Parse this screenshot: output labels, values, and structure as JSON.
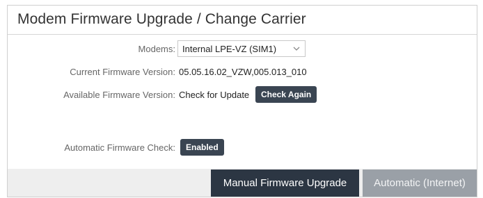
{
  "panel": {
    "title": "Modem Firmware Upgrade / Change Carrier"
  },
  "fields": {
    "modems": {
      "label": "Modems:",
      "selected": "Internal LPE-VZ (SIM1)"
    },
    "current_version": {
      "label": "Current Firmware Version:",
      "value": "05.05.16.02_VZW,005.013_010"
    },
    "available_version": {
      "label": "Available Firmware Version:",
      "value": "Check for Update",
      "button": "Check Again"
    },
    "auto_check": {
      "label": "Automatic Firmware Check:",
      "button": "Enabled"
    }
  },
  "footer": {
    "manual_button": "Manual Firmware Upgrade",
    "automatic_button": "Automatic (Internet)"
  },
  "colors": {
    "dark_button": "#3a4552",
    "primary_button": "#2c3643",
    "disabled_button": "#9aa0a7",
    "footer_bg": "#eeeeee"
  },
  "icons": {
    "select_arrow": "chevron-down-icon"
  }
}
